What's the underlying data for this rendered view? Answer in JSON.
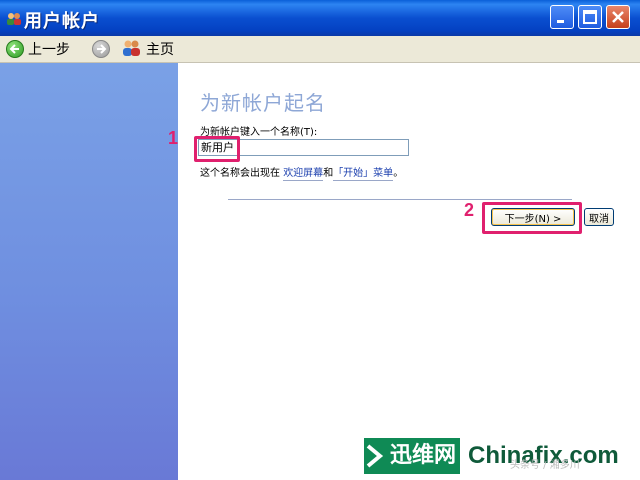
{
  "window": {
    "title": "用户帐户"
  },
  "nav": {
    "back_label": "上一步",
    "home_label": "主页"
  },
  "page": {
    "heading": "为新帐户起名",
    "field_label": "为新帐户键入一个名称(T):",
    "input_value": "新用户",
    "hint_prefix": "这个名称会出现在",
    "hint_link1": "欢迎屏幕",
    "hint_and": "和",
    "hint_link2": "「开始」菜单",
    "hint_suffix": "。"
  },
  "buttons": {
    "next_label": "下一步(N) >",
    "cancel_label": "取消"
  },
  "annotations": {
    "marker1": "1",
    "marker2": "2"
  },
  "watermark": {
    "brand": "迅维网",
    "site": "Chinafix.com",
    "sub": "头条号 / 湘多川"
  },
  "colors": {
    "marker": "#e0206e",
    "titlebar": "#0a4fd0",
    "sidebar": "#6f8fe0"
  }
}
